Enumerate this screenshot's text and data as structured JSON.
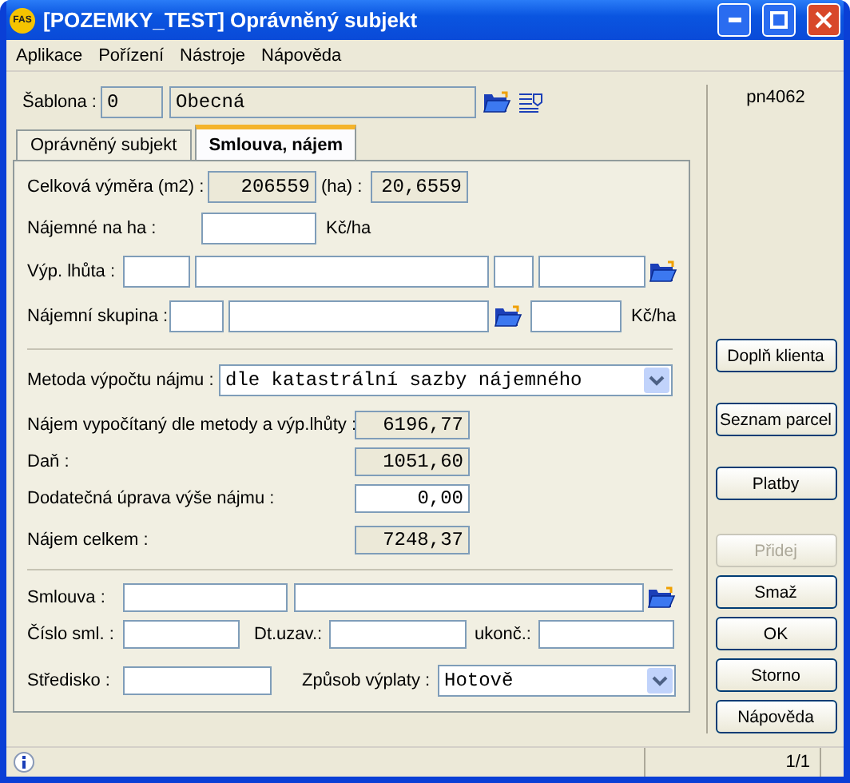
{
  "window": {
    "title": "[POZEMKY_TEST] Oprávněný subjekt",
    "logo": "FAS"
  },
  "menu": [
    "Aplikace",
    "Pořízení",
    "Nástroje",
    "Nápověda"
  ],
  "template": {
    "label": "Šablona :",
    "code": "0",
    "name": "Obecná"
  },
  "user": "pn4062",
  "tabs": [
    {
      "label": "Oprávněný subjekt",
      "selected": false
    },
    {
      "label": "Smlouva, nájem",
      "selected": true
    }
  ],
  "area": {
    "label": "Celková výměra (m2) :",
    "m2": "206559",
    "ha_label": "(ha) :",
    "ha": "20,6559"
  },
  "rent_per_ha": {
    "label": "Nájemné na ha :",
    "unit": "Kč/ha"
  },
  "period": {
    "label": "Výp. lhůta :"
  },
  "rent_group": {
    "label": "Nájemní skupina :",
    "unit": "Kč/ha"
  },
  "method": {
    "label": "Metoda výpočtu nájmu :",
    "value": "dle katastrální sazby nájemného"
  },
  "amounts": [
    {
      "label": "Nájem vypočítaný dle metody a výp.lhůty :",
      "value": "6196,77",
      "editable": false
    },
    {
      "label": "Daň :",
      "value": "1051,60",
      "editable": false
    },
    {
      "label": "Dodatečná úprava výše nájmu :",
      "value": "0,00",
      "editable": true
    },
    {
      "label": "Nájem celkem :",
      "value": "7248,37",
      "editable": false
    }
  ],
  "contract": {
    "label": "Smlouva :",
    "number_label": "Číslo sml. :",
    "date_label": "Dt.uzav.:",
    "end_label": "ukonč.:",
    "center_label": "Středisko :",
    "payout_label": "Způsob výplaty :",
    "payout": "Hotově"
  },
  "buttons": [
    {
      "label": "Doplň klienta",
      "disabled": false
    },
    {
      "label": "Seznam parcel",
      "disabled": false
    },
    {
      "label": "Platby",
      "disabled": false
    },
    {
      "label": "Přidej",
      "disabled": true
    },
    {
      "label": "Smaž",
      "disabled": false
    },
    {
      "label": "OK",
      "disabled": false
    },
    {
      "label": "Storno",
      "disabled": false
    },
    {
      "label": "Nápověda",
      "disabled": false
    }
  ],
  "status": {
    "page": "1/1"
  }
}
